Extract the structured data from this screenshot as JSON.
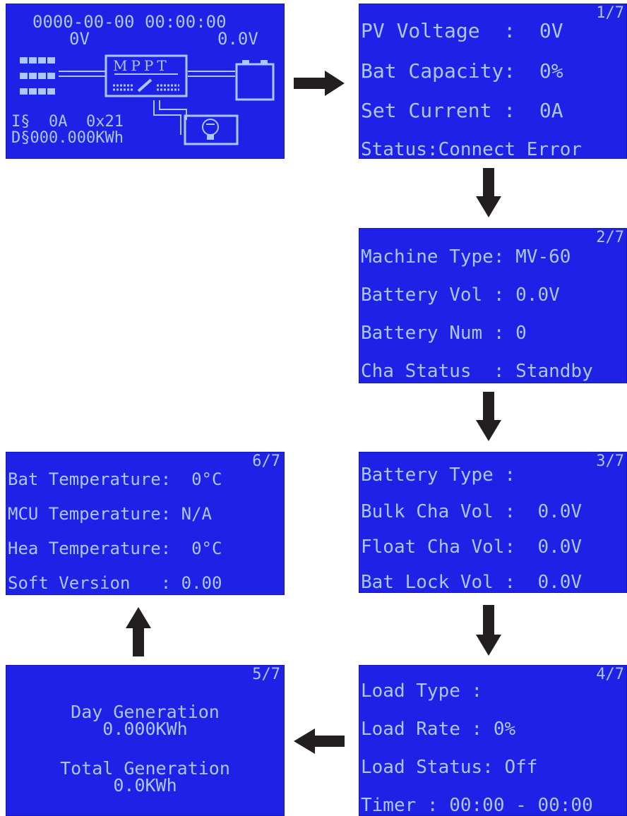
{
  "colors": {
    "lcd_bg": "#1f22e6",
    "lcd_text": "#a8c8ff",
    "arrow": "#231f20"
  },
  "screen0": {
    "datetime": "0000-00-00 00:00:00",
    "pv_voltage": "0V",
    "bat_voltage": "0.0V",
    "mppt_label": "MPPT",
    "current_line": "I§  0A  0x21",
    "energy_line": "D§000.000KWh",
    "icons": [
      "solar-panel-icon",
      "mppt-controller-icon",
      "battery-icon",
      "lamp-icon"
    ]
  },
  "screen1": {
    "page": "1/7",
    "lines": [
      "PV Voltage  :  0V",
      "Bat Capacity:  0%",
      "Set Current :  0A",
      "Status:Connect Error"
    ]
  },
  "screen2": {
    "page": "2/7",
    "lines": [
      "Machine Type: MV-60",
      "Battery Vol : 0.0V",
      "Battery Num : 0",
      "Cha Status  : Standby"
    ]
  },
  "screen3": {
    "page": "3/7",
    "lines": [
      "Battery Type :",
      "Bulk Cha Vol :  0.0V",
      "Float Cha Vol:  0.0V",
      "Bat Lock Vol :  0.0V"
    ]
  },
  "screen4": {
    "page": "4/7",
    "lines": [
      "Load Type :",
      "Load Rate : 0%",
      "Load Status: Off",
      "Timer : 00:00 - 00:00"
    ]
  },
  "screen5": {
    "page": "5/7",
    "lines": [
      "Day Generation",
      "0.000KWh",
      "Total Generation",
      "0.0KWh"
    ]
  },
  "screen6": {
    "page": "6/7",
    "lines": [
      "Bat Temperature:  0°C",
      "MCU Temperature: N/A",
      "Hea Temperature:  0°C",
      "Soft Version   : 0.00"
    ]
  }
}
